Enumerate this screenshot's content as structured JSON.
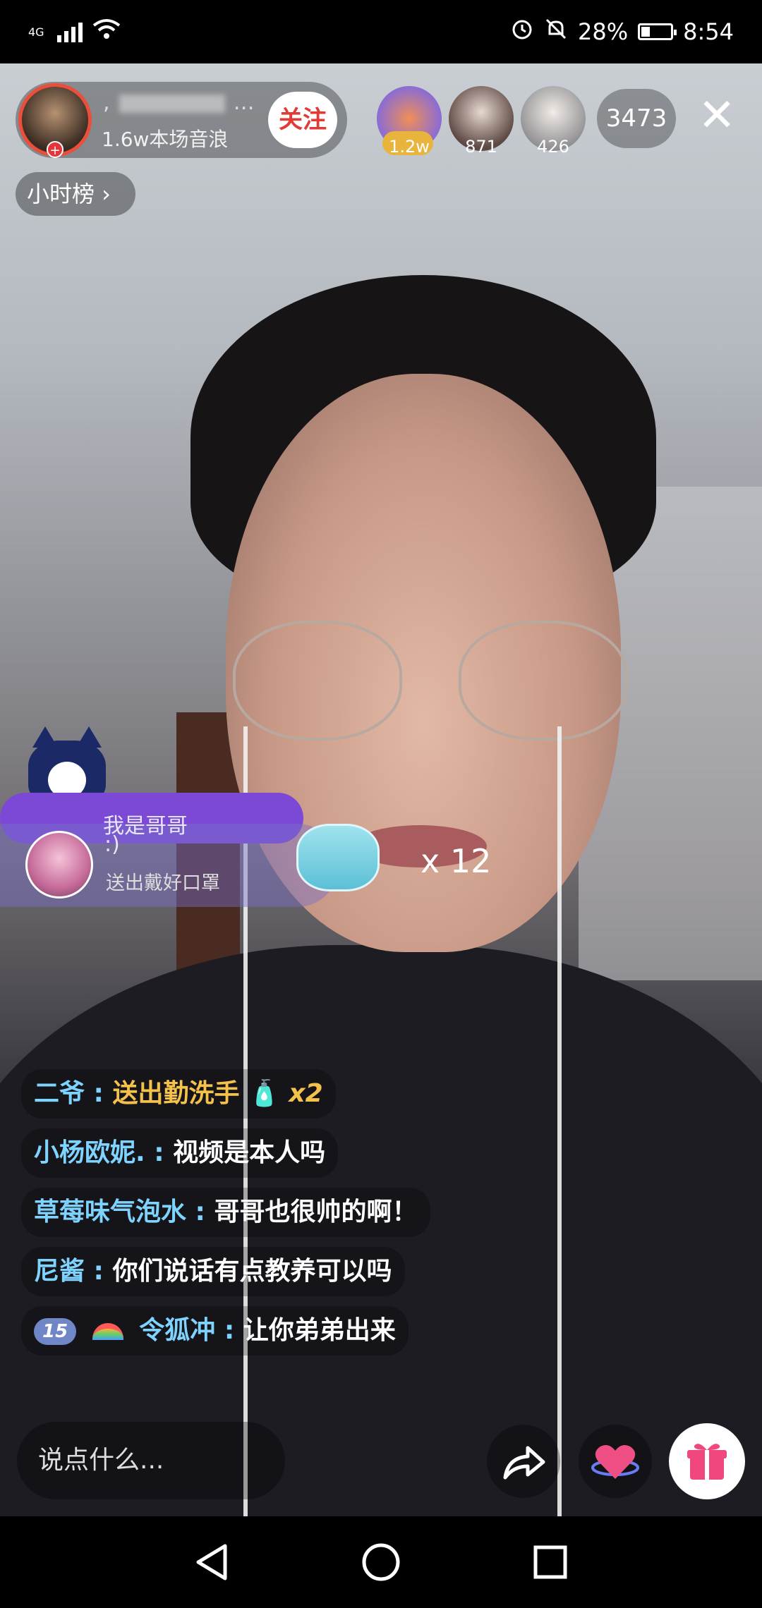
{
  "status_bar": {
    "network": "4G",
    "battery": "28%",
    "battery_level": 0.28,
    "time": "8:54",
    "icons": [
      "signal-icon",
      "wifi-icon",
      "alarm-icon",
      "mute-icon",
      "battery-icon"
    ]
  },
  "host": {
    "name": ",",
    "name_suffix": "…",
    "stats": "1.6w本场音浪",
    "follow_label": "关注"
  },
  "viewers": [
    {
      "count": "1.2w"
    },
    {
      "count": "871"
    },
    {
      "count": "426"
    }
  ],
  "online_count": "3473",
  "close_icon": "✕",
  "hour_rank": "小时榜 ›",
  "gift_banner": {
    "sender": "我是哥哥",
    "sender_suffix": ":)",
    "action": "送出戴好口罩",
    "multiplier": "x 12"
  },
  "comments": [
    {
      "user": "二爷 :",
      "text": "送出勤洗手",
      "mult": "x2",
      "gold": true
    },
    {
      "user": "小杨欧妮. :",
      "text": "视频是本人吗"
    },
    {
      "user": "草莓味气泡水 :",
      "text": "哥哥也很帅的啊！"
    },
    {
      "user": "尼酱 :",
      "text": "你们说话有点教养可以吗"
    },
    {
      "level": "15",
      "user": "令狐冲 :",
      "text": "让你弟弟出来"
    }
  ],
  "input": {
    "placeholder": "说点什么..."
  },
  "actions": [
    "share-icon",
    "heart-icon",
    "gift-icon"
  ],
  "navbar": [
    "back-icon",
    "home-icon",
    "recents-icon"
  ],
  "colors": {
    "accent": "#e23b36",
    "comment_user": "#7fd3ff",
    "gold": "#f4c24a",
    "gift_bar": "#7b49d6"
  }
}
